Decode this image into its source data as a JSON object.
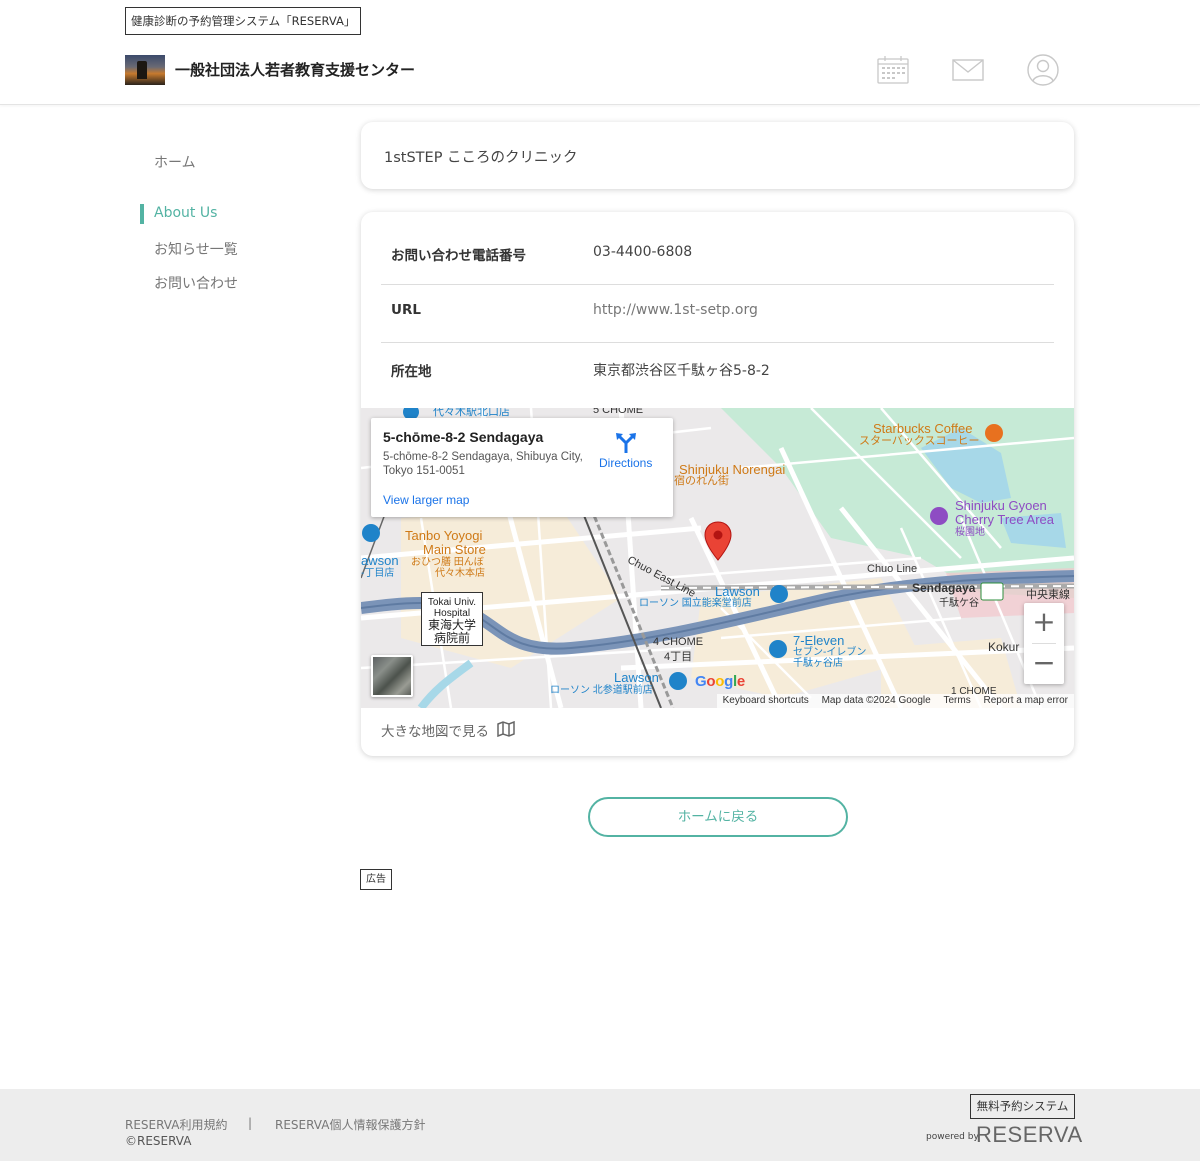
{
  "header": {
    "system_tag": "健康診断の予約管理システム「RESERVA」",
    "org_name": "一般社団法人若者教育支援センター",
    "icons": [
      "calendar-icon",
      "mail-icon",
      "user-icon"
    ]
  },
  "sidebar": {
    "items": [
      {
        "label": "ホーム",
        "active": false
      },
      {
        "label": "About Us",
        "active": true
      },
      {
        "label": "お知らせ一覧",
        "active": false
      },
      {
        "label": "お問い合わせ",
        "active": false
      }
    ]
  },
  "main": {
    "title": "1stSTEP こころのクリニック",
    "info": [
      {
        "key": "お問い合わせ電話番号",
        "value": "03-4400-6808"
      },
      {
        "key": "URL",
        "value": "http://www.1st-setp.org"
      },
      {
        "key": "所在地",
        "value": "東京都渋谷区千駄ヶ谷5-8-2"
      }
    ],
    "map": {
      "infowindow": {
        "title": "5-chōme-8-2 Sendagaya",
        "address": "5-chōme-8-2 Sendagaya, Shibuya City, Tokyo 151-0051",
        "larger_map": "View larger map",
        "directions": "Directions"
      },
      "labels": {
        "starbucks_en": "Starbucks Coffee",
        "starbucks_jp": "スターバックスコーヒー",
        "norengai_en": "Shinjuku Norengai",
        "norengai_jp": "宿のれん街",
        "gyoen_en1": "Shinjuku Gyoen",
        "gyoen_en2": "Cherry Tree Area",
        "gyoen_jp": "桜園地",
        "tanbo_en1": "Tanbo Yoyogi",
        "tanbo_en2": "Main Store",
        "tanbo_jp1": "おひつ膳 田んぼ",
        "tanbo_jp2": "代々木本店",
        "lawson_left": "awson",
        "lawson_left_jp": "-丁目店",
        "chuo_east": "Chuo East Line",
        "chuo_line": "Chuo Line",
        "lawson_mid_en": "Lawson",
        "lawson_mid_jp": "ローソン 国立能楽堂前店",
        "sendagaya_en": "Sendagaya",
        "sendagaya_jp": "千駄ケ谷",
        "jr_east": "中央東線",
        "seven_en": "7-Eleven",
        "seven_jp1": "セブン-イレブン",
        "seven_jp2": "千駄ヶ谷店",
        "chome4_en": "4 CHOME",
        "chome4_jp": "4丁目",
        "lawson_bot_en": "Lawson",
        "lawson_bot_jp": "ローソン 北参道駅前店",
        "koku": "Kokur",
        "chome1": "1 CHOME",
        "yoyogi_north": "代々木駅北口店",
        "chome_top": "5 CHOME",
        "hosp_en1": "Tokai Univ.",
        "hosp_en2": "Hospital",
        "hosp_jp1": "東海大学",
        "hosp_jp2": "病院前"
      },
      "zoom_in": "+",
      "zoom_out": "−",
      "google": "Google",
      "attribution": {
        "shortcuts": "Keyboard shortcuts",
        "data": "Map data ©2024 Google",
        "terms": "Terms",
        "report": "Report a map error"
      }
    },
    "larger_map_link": "大きな地図で見る",
    "back_button": "ホームに戻る",
    "ad_label": "広告"
  },
  "footer": {
    "terms": "RESERVA利用規約",
    "separator": "|",
    "privacy": "RESERVA個人情報保護方針",
    "copyright": "©RESERVA",
    "free_tag": "無料予約システム",
    "powered_by": "powered by",
    "brand": "RESERVA"
  },
  "colors": {
    "accent": "#53b3a3",
    "map_blue": "#1a73e8",
    "pin_red": "#ea4335"
  }
}
